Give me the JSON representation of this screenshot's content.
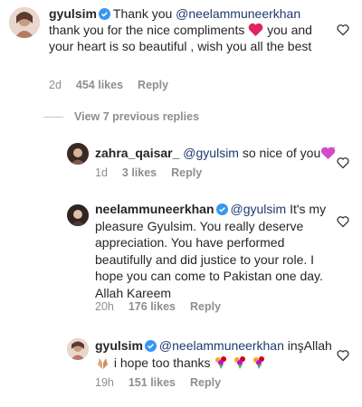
{
  "comments": [
    {
      "username": "gyulsim",
      "verified": true,
      "mention": "@neelammuneerkhan",
      "text_before_emoji": "thank you for the nice compliments",
      "text_after_emoji": "you and your heart is so beautiful , wish you all the best",
      "prefix": "Thank you",
      "age": "2d",
      "likes": "454 likes",
      "reply": "Reply"
    },
    {
      "username": "zahra_qaisar_",
      "verified": false,
      "mention": "@gyulsim",
      "text": "so nice of you",
      "age": "1d",
      "likes": "3 likes",
      "reply": "Reply"
    },
    {
      "username": "neelammuneerkhan",
      "verified": true,
      "mention": "@gyulsim",
      "text": "It's my pleasure Gyulsim. You really deserve appreciation. You have performed beautifully and did justice to your role. I hope you can come to Pakistan one day. Allah Kareem",
      "age": "20h",
      "likes": "176 likes",
      "reply": "Reply"
    },
    {
      "username": "gyulsim",
      "verified": true,
      "mention": "@neelammuneerkhan",
      "text_inline": "inşAllah",
      "text": "i hope too thanks",
      "age": "19h",
      "likes": "151 likes",
      "reply": "Reply"
    }
  ],
  "view_replies": "View 7 previous replies",
  "colors": {
    "mention": "#1f3a6e",
    "meta": "#8e8e8e",
    "verified": "#3897f0",
    "heart_emoji": "#e0245e"
  },
  "icons": [
    "heart-outline-icon",
    "verified-badge-icon",
    "red-heart-emoji",
    "purple-heart-emoji",
    "praying-hands-emoji",
    "bouquet-emoji"
  ]
}
